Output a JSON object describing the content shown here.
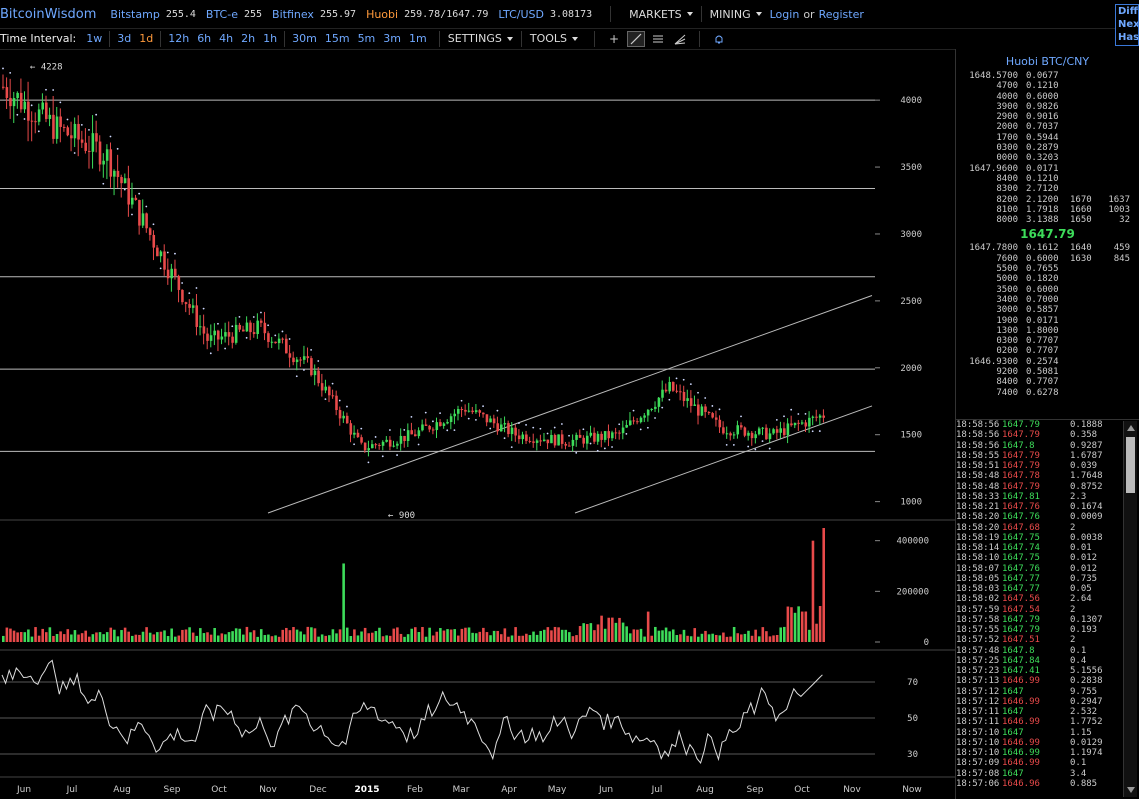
{
  "header": {
    "logo": "BitcoinWisdom",
    "tickers": [
      {
        "name": "Bitstamp",
        "value": "255.4"
      },
      {
        "name": "BTC-e",
        "value": "255"
      },
      {
        "name": "Bitfinex",
        "value": "255.97"
      },
      {
        "name": "Huobi",
        "value": "259.78/1647.79",
        "highlight": true
      },
      {
        "name": "LTC/USD",
        "value": "3.08173"
      }
    ],
    "markets_label": "MARKETS",
    "mining_label": "MINING",
    "login_label": "Login",
    "or_label": "or",
    "register_label": "Register",
    "difficulty_lines": [
      "Diffi",
      "Next",
      "Hash"
    ]
  },
  "toolbar": {
    "time_interval_label": "Time Interval:",
    "intervals": [
      "1w",
      "3d",
      "1d",
      "12h",
      "6h",
      "4h",
      "2h",
      "1h",
      "30m",
      "15m",
      "5m",
      "3m",
      "1m"
    ],
    "active_interval": "1d",
    "settings_label": "SETTINGS",
    "tools_label": "TOOLS"
  },
  "chart": {
    "price_ticks": [
      "4000",
      "3500",
      "3000",
      "2500",
      "2000",
      "1500",
      "1000"
    ],
    "volume_ticks": [
      "400000",
      "200000",
      "0"
    ],
    "osc_ticks": [
      "70",
      "50",
      "30"
    ],
    "x_labels": [
      "Jun",
      "Jul",
      "Aug",
      "Sep",
      "Oct",
      "Nov",
      "Dec",
      "2015",
      "Feb",
      "Mar",
      "Apr",
      "May",
      "Jun",
      "Jul",
      "Aug",
      "Sep",
      "Oct",
      "Nov",
      "Now"
    ],
    "high_marker": "4228",
    "low_marker": "900",
    "colors": {
      "up": "#3ddc5a",
      "down": "#e84a4a",
      "line": "#dddddd",
      "grid": "#888888",
      "sar": "#cfd9ff"
    }
  },
  "chart_data": {
    "type": "candlestick",
    "x": [
      "Jun",
      "Jul",
      "Aug",
      "Sep",
      "Oct",
      "Nov",
      "Dec",
      "2015",
      "Feb",
      "Mar",
      "Apr",
      "May",
      "Jun",
      "Jul",
      "Aug",
      "Sep",
      "Oct"
    ],
    "close": [
      4100,
      3800,
      3600,
      2900,
      2200,
      2300,
      2000,
      1400,
      1500,
      1700,
      1500,
      1450,
      1500,
      1850,
      1550,
      1500,
      1647
    ],
    "ylim": [
      900,
      4300
    ],
    "volume_ylim": [
      0,
      450000
    ],
    "oscillator_ylim": [
      20,
      85
    ]
  },
  "orderbook": {
    "title": "Huobi BTC/CNY",
    "asks": [
      [
        "1648.5700",
        "0.0677",
        "",
        ""
      ],
      [
        "4700",
        "0.1210",
        "",
        ""
      ],
      [
        "4000",
        "0.6000",
        "",
        ""
      ],
      [
        "3900",
        "0.9826",
        "",
        ""
      ],
      [
        "2900",
        "0.9016",
        "",
        ""
      ],
      [
        "2000",
        "0.7037",
        "",
        ""
      ],
      [
        "1700",
        "0.5944",
        "",
        ""
      ],
      [
        "0300",
        "0.2879",
        "",
        ""
      ],
      [
        "0000",
        "0.3203",
        "",
        ""
      ],
      [
        "1647.9600",
        "0.0171",
        "",
        ""
      ],
      [
        "8400",
        "0.1210",
        "",
        ""
      ],
      [
        "8300",
        "2.7120",
        "",
        ""
      ],
      [
        "8200",
        "2.1200",
        "1670",
        "1637"
      ],
      [
        "8100",
        "1.7918",
        "1660",
        "1003"
      ],
      [
        "8000",
        "3.1388",
        "1650",
        "32"
      ]
    ],
    "last_price": "1647.79",
    "bids": [
      [
        "1647.7800",
        "0.1612",
        "1640",
        "459"
      ],
      [
        "7600",
        "0.6000",
        "1630",
        "845"
      ],
      [
        "5500",
        "0.7655",
        "",
        ""
      ],
      [
        "5000",
        "0.1820",
        "",
        ""
      ],
      [
        "3500",
        "0.6000",
        "",
        ""
      ],
      [
        "3400",
        "0.7000",
        "",
        ""
      ],
      [
        "3000",
        "0.5857",
        "",
        ""
      ],
      [
        "1900",
        "0.0171",
        "",
        ""
      ],
      [
        "1300",
        "1.8000",
        "",
        ""
      ],
      [
        "0300",
        "0.7707",
        "",
        ""
      ],
      [
        "0200",
        "0.7707",
        "",
        ""
      ],
      [
        "1646.9300",
        "0.2574",
        "",
        ""
      ],
      [
        "9200",
        "0.5081",
        "",
        ""
      ],
      [
        "8400",
        "0.7707",
        "",
        ""
      ],
      [
        "7400",
        "0.6278",
        "",
        ""
      ]
    ]
  },
  "trades": [
    [
      "18:58:56",
      "1647.79",
      "up",
      "0.1888"
    ],
    [
      "18:58:56",
      "1647.79",
      "dn",
      "0.358"
    ],
    [
      "18:58:56",
      "1647.8",
      "up",
      "0.9287"
    ],
    [
      "18:58:55",
      "1647.79",
      "dn",
      "1.6787"
    ],
    [
      "18:58:51",
      "1647.79",
      "dn",
      "0.039"
    ],
    [
      "18:58:48",
      "1647.78",
      "dn",
      "1.7648"
    ],
    [
      "18:58:48",
      "1647.79",
      "dn",
      "0.8752"
    ],
    [
      "18:58:33",
      "1647.81",
      "up",
      "2.3"
    ],
    [
      "18:58:21",
      "1647.76",
      "dn",
      "0.1674"
    ],
    [
      "18:58:20",
      "1647.76",
      "up",
      "0.0009"
    ],
    [
      "18:58:20",
      "1647.68",
      "dn",
      "2"
    ],
    [
      "18:58:19",
      "1647.75",
      "up",
      "0.0038"
    ],
    [
      "18:58:14",
      "1647.74",
      "up",
      "0.01"
    ],
    [
      "18:58:10",
      "1647.75",
      "up",
      "0.012"
    ],
    [
      "18:58:07",
      "1647.76",
      "up",
      "0.012"
    ],
    [
      "18:58:05",
      "1647.77",
      "up",
      "0.735"
    ],
    [
      "18:58:03",
      "1647.77",
      "up",
      "0.05"
    ],
    [
      "18:58:02",
      "1647.56",
      "dn",
      "2.64"
    ],
    [
      "18:57:59",
      "1647.54",
      "dn",
      "2"
    ],
    [
      "18:57:58",
      "1647.79",
      "up",
      "0.1307"
    ],
    [
      "18:57:55",
      "1647.79",
      "up",
      "0.193"
    ],
    [
      "18:57:52",
      "1647.51",
      "dn",
      "2"
    ],
    [
      "18:57:48",
      "1647.8",
      "up",
      "0.1"
    ],
    [
      "18:57:25",
      "1647.84",
      "up",
      "0.4"
    ],
    [
      "18:57:23",
      "1647.41",
      "up",
      "5.1556"
    ],
    [
      "18:57:13",
      "1646.99",
      "dn",
      "0.2838"
    ],
    [
      "18:57:12",
      "1647",
      "up",
      "9.755"
    ],
    [
      "18:57:12",
      "1646.99",
      "dn",
      "0.2947"
    ],
    [
      "18:57:11",
      "1647",
      "up",
      "2.532"
    ],
    [
      "18:57:11",
      "1646.99",
      "dn",
      "1.7752"
    ],
    [
      "18:57:10",
      "1647",
      "up",
      "1.15"
    ],
    [
      "18:57:10",
      "1646.99",
      "dn",
      "0.0129"
    ],
    [
      "18:57:10",
      "1646.99",
      "up",
      "1.1974"
    ],
    [
      "18:57:09",
      "1646.99",
      "dn",
      "0.1"
    ],
    [
      "18:57:08",
      "1647",
      "up",
      "3.4"
    ],
    [
      "18:57:06",
      "1646.96",
      "dn",
      "0.885"
    ]
  ]
}
